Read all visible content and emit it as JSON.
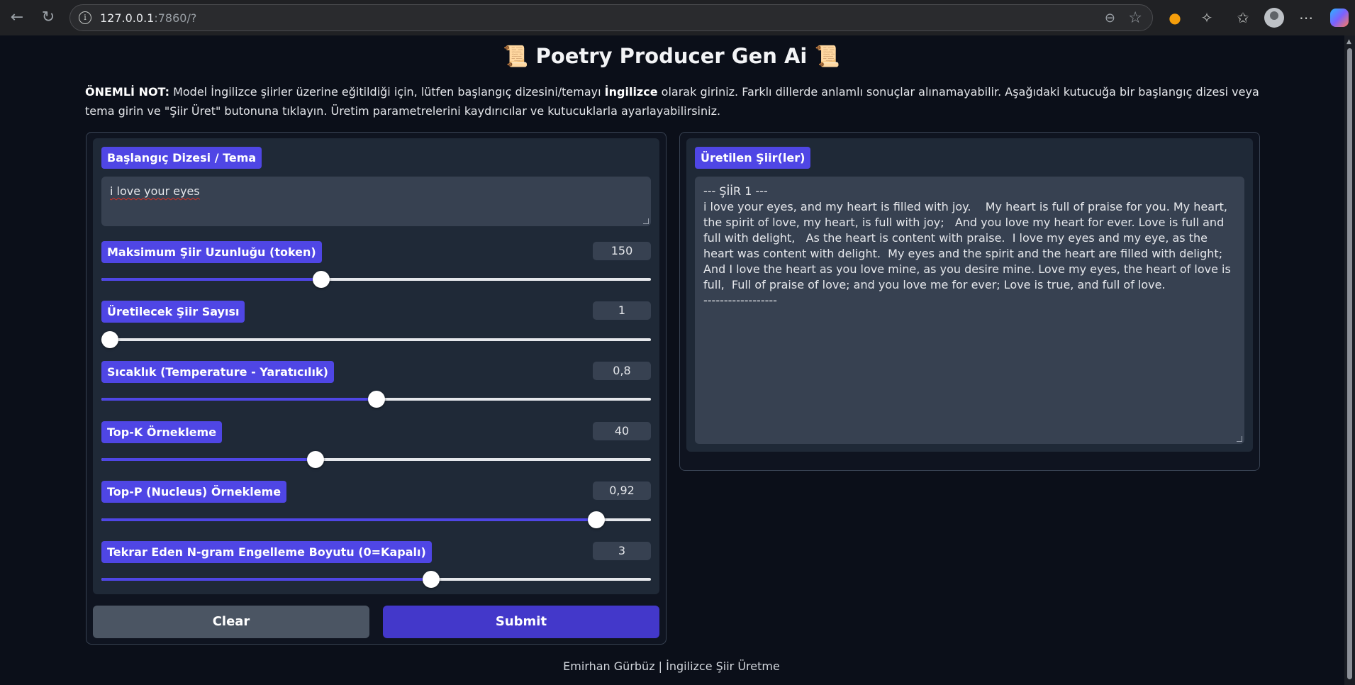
{
  "browser": {
    "url_host": "127.0.0.1",
    "url_path": ":7860/?"
  },
  "app": {
    "title": "📜 Poetry Producer Gen Ai 📜",
    "note_label": "ÖNEMLİ NOT:",
    "note_part1": " Model İngilizce şiirler üzerine eğitildiği için, lütfen başlangıç dizesini/temayı ",
    "note_bold_word": "İngilizce",
    "note_part2": " olarak giriniz. Farklı dillerde anlamlı sonuçlar alınamayabilir. Aşağıdaki kutucuğa bir başlangıç dizesi veya tema girin ve \"Şiir Üret\" butonuna tıklayın. Üretim parametrelerini kaydırıcılar ve kutucuklarla ayarlayabilirsiniz."
  },
  "inputs": {
    "prompt_label": "Başlangıç Dizesi / Tema",
    "prompt_value": "i love your eyes",
    "sliders": [
      {
        "label": "Maksimum Şiir Uzunluğu (token)",
        "value": "150",
        "fraction": 0.4
      },
      {
        "label": "Üretilecek Şiir Sayısı",
        "value": "1",
        "fraction": 0.0
      },
      {
        "label": "Sıcaklık (Temperature - Yaratıcılık)",
        "value": "0,8",
        "fraction": 0.5
      },
      {
        "label": "Top-K Örnekleme",
        "value": "40",
        "fraction": 0.39
      },
      {
        "label": "Top-P (Nucleus) Örnekleme",
        "value": "0,92",
        "fraction": 0.9
      },
      {
        "label": "Tekrar Eden N-gram Engelleme Boyutu (0=Kapalı)",
        "value": "3",
        "fraction": 0.6
      }
    ],
    "clear_label": "Clear",
    "submit_label": "Submit"
  },
  "output": {
    "label": "Üretilen Şiir(ler)",
    "text": "--- ŞİİR 1 ---\ni love your eyes, and my heart is filled with joy.    My heart is full of praise for you. My heart, the spirit of love, my heart, is full with joy;   And you love my heart for ever. Love is full and full with delight,   As the heart is content with praise.  I love my eyes and my eye, as the heart was content with delight.  My eyes and the spirit and the heart are filled with delight;  And I love the heart as you love mine, as you desire mine. Love my eyes, the heart of love is full,  Full of praise of love; and you love me for ever; Love is true, and full of love.\n------------------"
  },
  "footer": "Emirhan Gürbüz | İngilizce Şiir Üretme"
}
